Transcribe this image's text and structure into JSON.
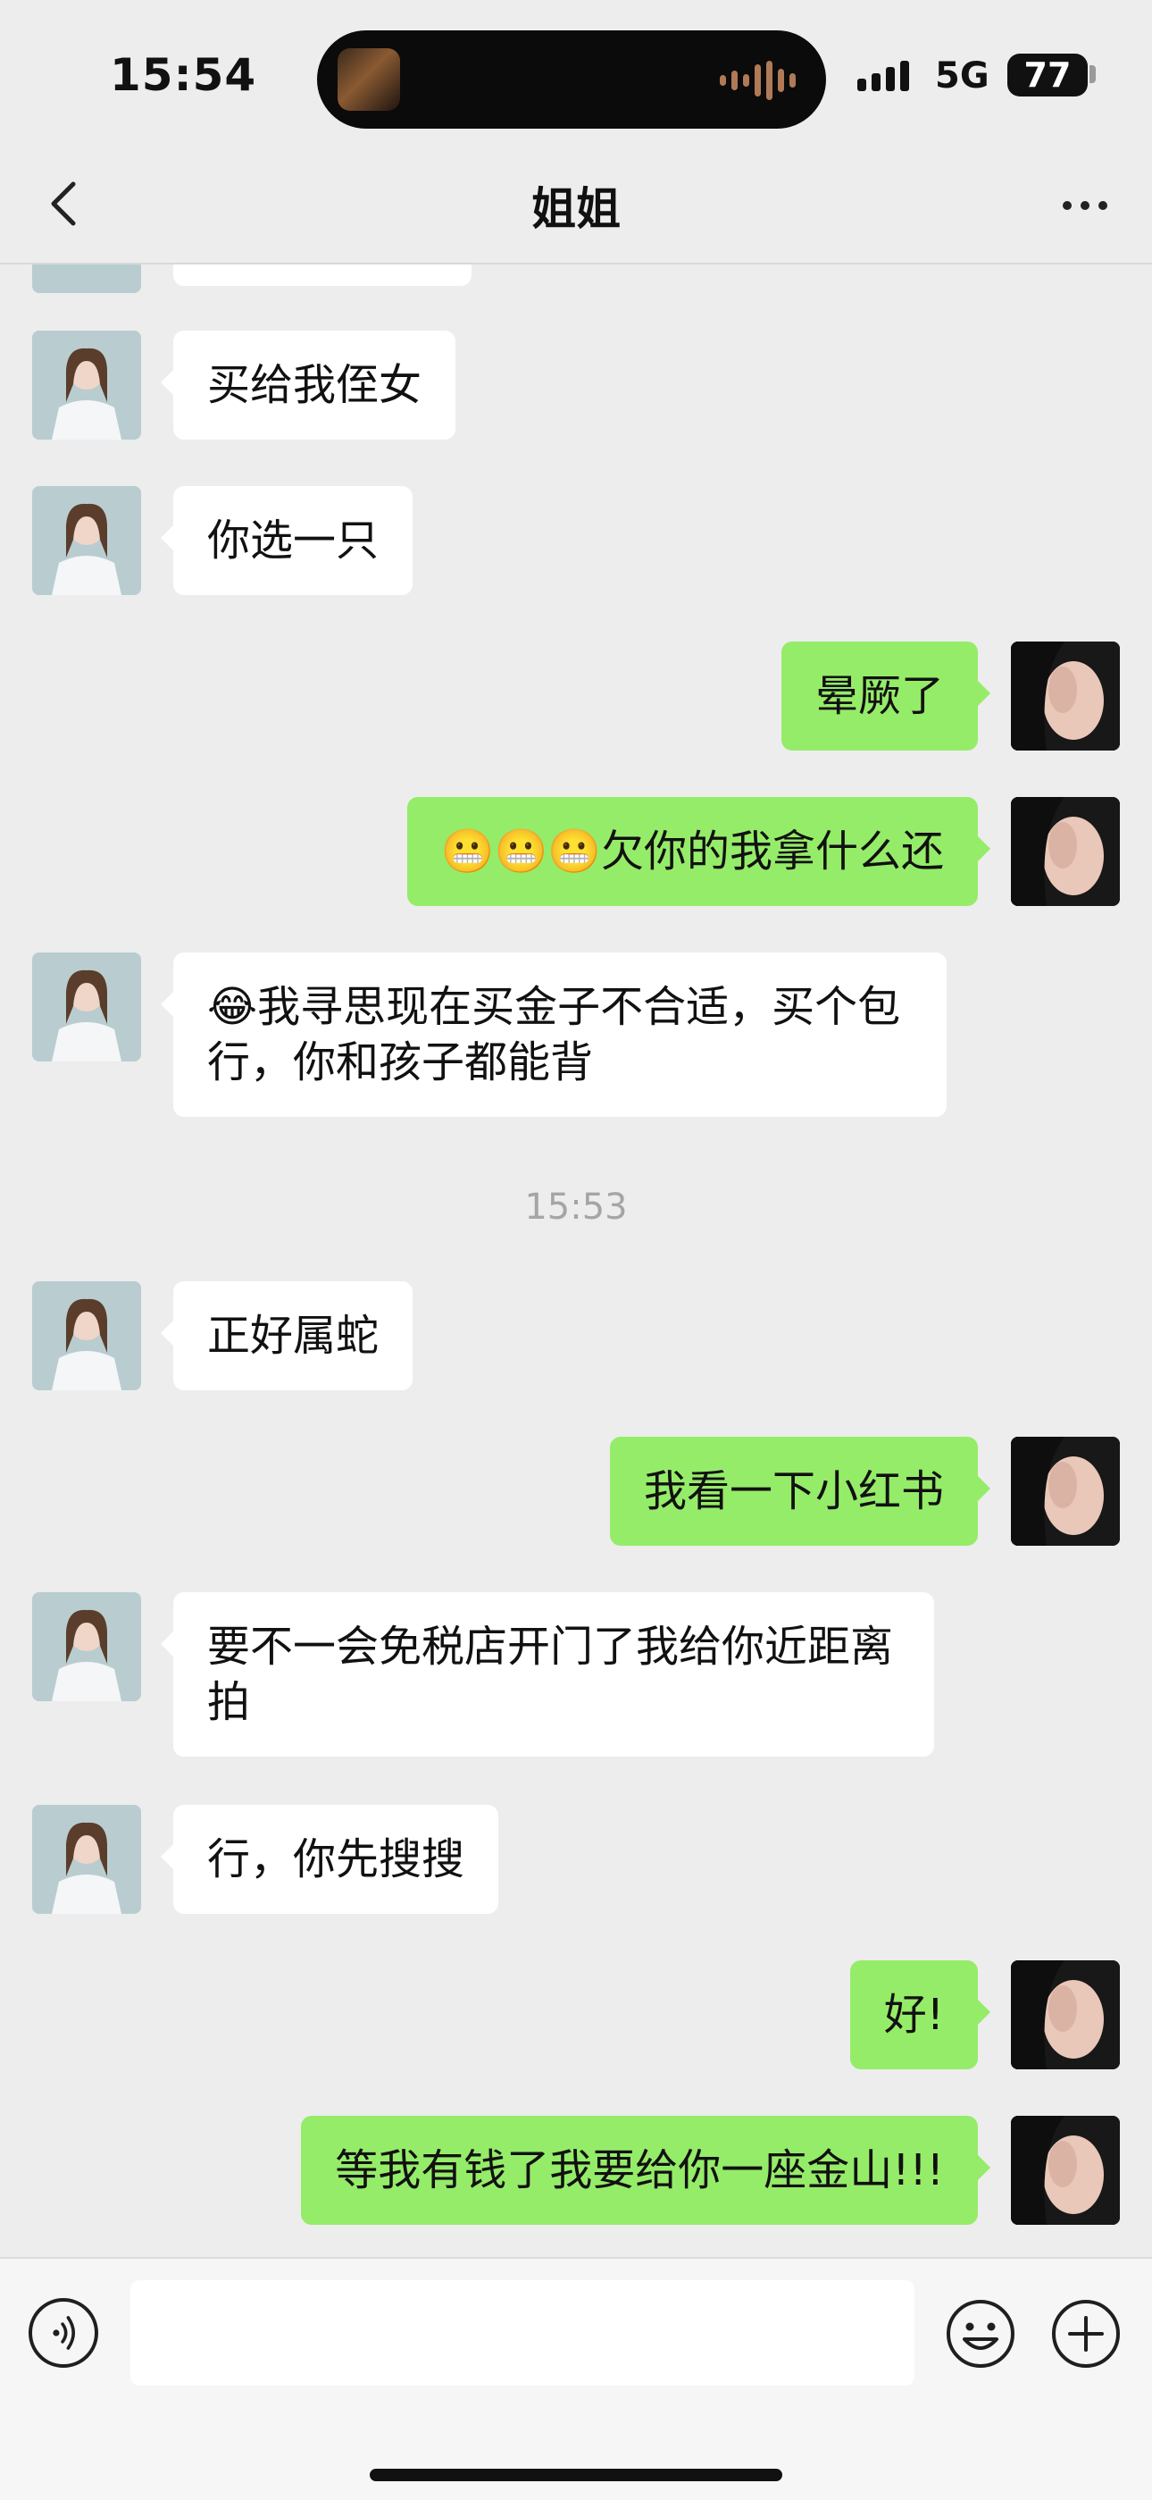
{
  "status_bar": {
    "time": "15:54",
    "network": "5G",
    "battery": "77"
  },
  "nav": {
    "title": "姐姐"
  },
  "messages": [
    {
      "side": "in",
      "text": "买给我侄女"
    },
    {
      "side": "in",
      "text": "你选一只"
    },
    {
      "side": "out",
      "text": "晕厥了"
    },
    {
      "side": "out",
      "text": "😬😬😬欠你的我拿什么还"
    },
    {
      "side": "in",
      "text": "😂我寻思现在买金子不合适，买个包行，你和孩子都能背"
    },
    {
      "side": "in",
      "text": "正好属蛇"
    },
    {
      "side": "out",
      "text": "我看一下小红书"
    },
    {
      "side": "in",
      "text": "要不一会免税店开门了我给你近距离拍"
    },
    {
      "side": "in",
      "text": "行，你先搜搜"
    },
    {
      "side": "out",
      "text": "好!"
    },
    {
      "side": "out",
      "text": "等我有钱了我要给你一座金山!!!"
    }
  ],
  "timestamp": "15:53",
  "input": {
    "placeholder": ""
  },
  "colors": {
    "incoming": "#ffffff",
    "outgoing": "#95ec69",
    "background": "#ededed"
  }
}
